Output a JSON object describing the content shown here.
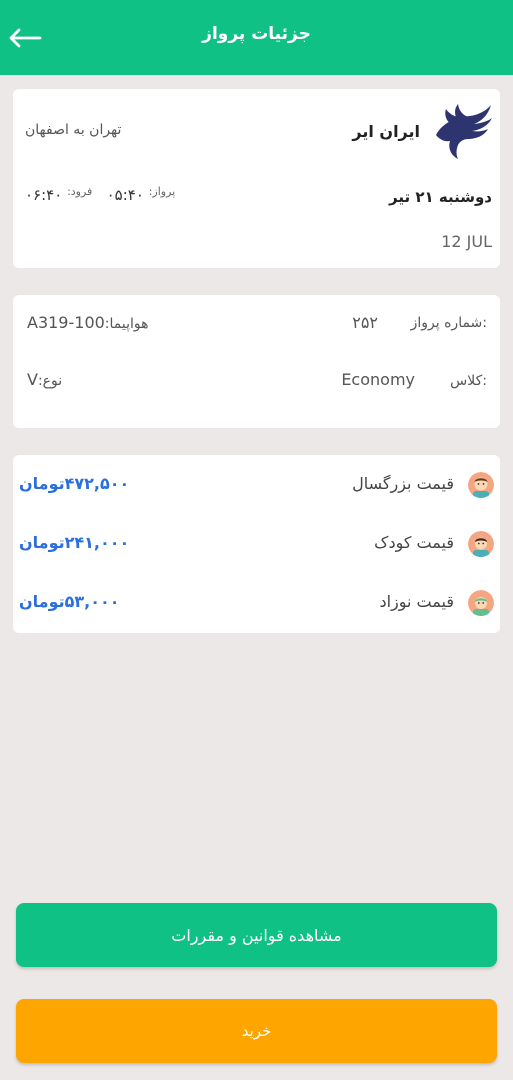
{
  "header": {
    "title": "جزئیات پرواز"
  },
  "flight": {
    "airline_name": "ایران ایر",
    "route": "تهران به اصفهان",
    "date_fa": "دوشنبه ۲۱ تیر",
    "date_en": "12 JUL",
    "departure_label": "پرواز:",
    "departure_time": "۰۵:۴۰",
    "arrival_label": "فرود:",
    "arrival_time": "۰۶:۴۰"
  },
  "details": {
    "flight_number_label": "شماره پرواز:",
    "flight_number": "۲۵۲",
    "aircraft_label": "هواپیما:",
    "aircraft": "A319-100",
    "class_label": "کلاس:",
    "class_value": "Economy",
    "type_label": "نوع:",
    "type_value": "V"
  },
  "prices": [
    {
      "label": "قیمت بزرگسال",
      "amount": "۴۷۲,۵۰۰",
      "currency": "تومان",
      "avatar": "adult-avatar"
    },
    {
      "label": "قیمت کودک",
      "amount": "۲۴۱,۰۰۰",
      "currency": "تومان",
      "avatar": "child-avatar"
    },
    {
      "label": "قیمت نوزاد",
      "amount": "۵۳,۰۰۰",
      "currency": "تومان",
      "avatar": "infant-avatar"
    }
  ],
  "buttons": {
    "rules": "مشاهده قوانین و مقررات",
    "buy": "خرید"
  },
  "colors": {
    "primary": "#10c185",
    "accent": "#ffa500",
    "price": "#2a6fdb",
    "background": "#ece8e8"
  },
  "icons": {
    "back": "arrow-left-icon",
    "logo": "iran-air-logo"
  }
}
